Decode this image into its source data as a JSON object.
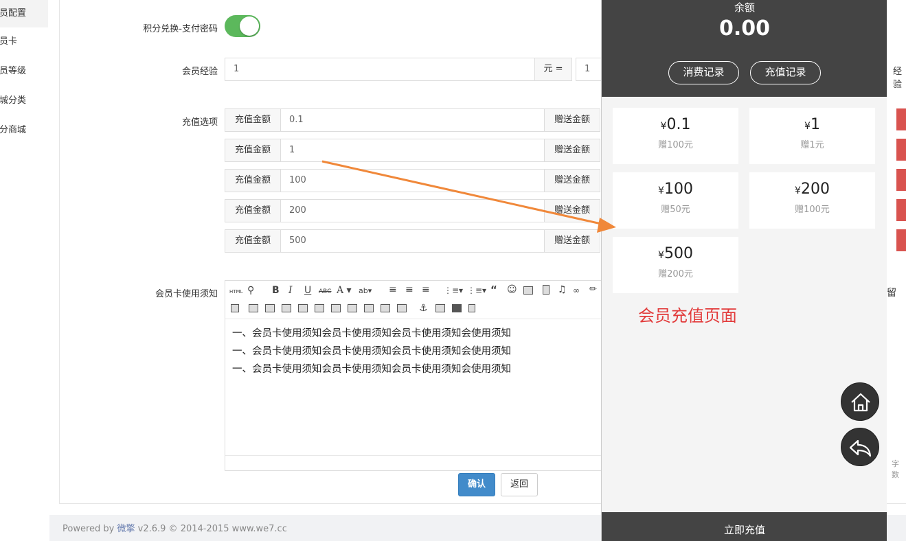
{
  "sidebar": {
    "items": [
      {
        "label": "会员配置"
      },
      {
        "label": "会员卡"
      },
      {
        "label": "会员等级"
      },
      {
        "label": "商城分类"
      },
      {
        "label": "积分商城"
      }
    ]
  },
  "form": {
    "points_exchange_label": "积分兑换-支付密码",
    "points_exchange_enabled": true,
    "exp_label": "会员经验",
    "exp_value": "1",
    "exp_unit": "元 =",
    "exp_value2": "1",
    "exp_right_frag": "经验",
    "recharge_label": "充值选项",
    "recharge_options": [
      {
        "amount_label": "充值金额",
        "amount": "0.1",
        "gift_label": "赠送金额"
      },
      {
        "amount_label": "充值金额",
        "amount": "1",
        "gift_label": "赠送金额"
      },
      {
        "amount_label": "充值金额",
        "amount": "100",
        "gift_label": "赠送金额"
      },
      {
        "amount_label": "充值金额",
        "amount": "200",
        "gift_label": "赠送金额"
      },
      {
        "amount_label": "充值金额",
        "amount": "500",
        "gift_label": "赠送金额"
      }
    ],
    "notice_label": "会员卡使用须知",
    "editor_lines": [
      "一、会员卡使用须知会员卡使用须知会员卡使用须知会使用须知",
      "一、会员卡使用须知会员卡使用须知会员卡使用须知会使用须知",
      "一、会员卡使用须知会员卡使用须知会员卡使用须知会使用须知"
    ],
    "editor_right_frag": "留",
    "word_count_frag": "字数",
    "confirm_label": "确认",
    "back_label": "返回"
  },
  "footer": {
    "powered": "Powered by",
    "brand": "微擎",
    "rest": "v2.6.9 © 2014-2015 www.we7.cc"
  },
  "phone": {
    "balance_label": "余额",
    "balance_value": "0.00",
    "consume_record_label": "消费记录",
    "recharge_record_label": "充值记录",
    "options": [
      {
        "yen": "¥",
        "amount": "0.1",
        "gift": "赠100元"
      },
      {
        "yen": "¥",
        "amount": "1",
        "gift": "赠1元"
      },
      {
        "yen": "¥",
        "amount": "100",
        "gift": "赠50元"
      },
      {
        "yen": "¥",
        "amount": "200",
        "gift": "赠100元"
      },
      {
        "yen": "¥",
        "amount": "500",
        "gift": "赠200元"
      }
    ],
    "caption": "会员充值页面",
    "recharge_now_label": "立即充值"
  },
  "colors": {
    "toggle_on": "#5cb85c",
    "primary": "#428bca",
    "phone_dark": "#444444",
    "caption_red": "#e23b3b",
    "arrow_orange": "#f0883a",
    "danger": "#d9534f"
  },
  "icons": {
    "home": "home-icon",
    "back": "back-arrow-icon"
  }
}
